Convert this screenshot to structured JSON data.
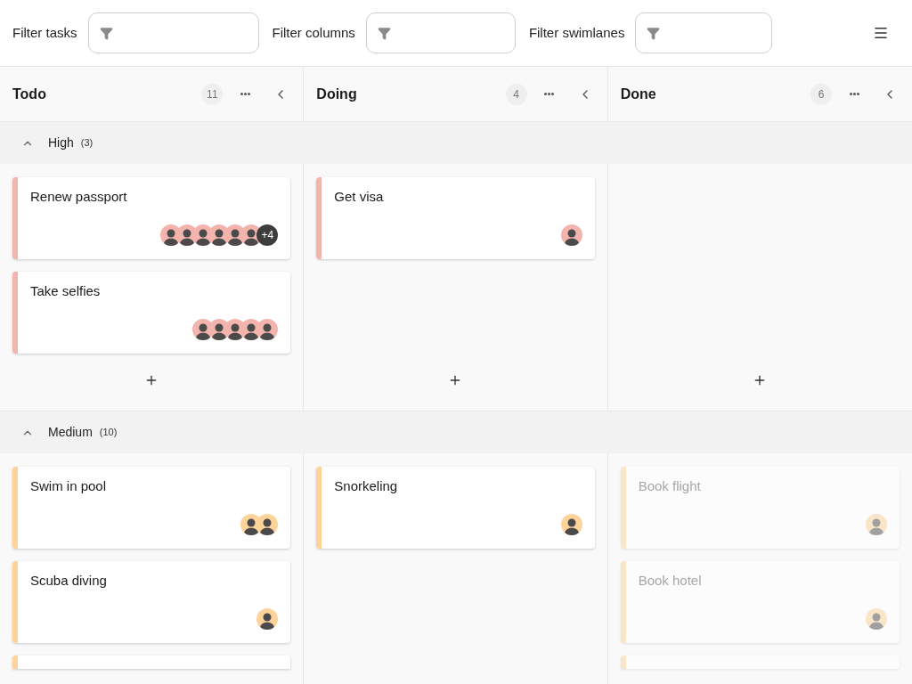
{
  "toolbar": {
    "filters": [
      {
        "label": "Filter tasks"
      },
      {
        "label": "Filter columns"
      },
      {
        "label": "Filter swimlanes"
      }
    ]
  },
  "columns": [
    {
      "title": "Todo",
      "count": "11"
    },
    {
      "title": "Doing",
      "count": "4"
    },
    {
      "title": "Done",
      "count": "6"
    }
  ],
  "swimlanes": [
    {
      "title": "High",
      "count": "(3)",
      "expanded": true,
      "color": "#f4b4ae",
      "add_button": true,
      "cells": [
        {
          "cards": [
            {
              "kind": "task",
              "title": "Renew passport",
              "completed": false,
              "avatars": [
                {
                  "kind": "photo"
                },
                {
                  "kind": "photo"
                },
                {
                  "kind": "photo"
                },
                {
                  "kind": "photo"
                },
                {
                  "kind": "photo"
                },
                {
                  "kind": "photo"
                },
                {
                  "kind": "more",
                  "label": "+4"
                }
              ]
            },
            {
              "kind": "task",
              "title": "Take selfies",
              "completed": false,
              "avatars": [
                {
                  "kind": "photo"
                },
                {
                  "kind": "photo"
                },
                {
                  "kind": "photo"
                },
                {
                  "kind": "photo"
                },
                {
                  "kind": "photo"
                }
              ]
            }
          ]
        },
        {
          "cards": [
            {
              "kind": "task",
              "title": "Get visa",
              "completed": false,
              "avatars": [
                {
                  "kind": "photo"
                }
              ]
            }
          ]
        },
        {}
      ]
    },
    {
      "title": "Medium",
      "count": "(10)",
      "expanded": true,
      "color": "#fdd39a",
      "cells": [
        {
          "cards": [
            {
              "kind": "task",
              "title": "Swim in pool",
              "completed": false,
              "avatars": [
                {
                  "kind": "photo"
                },
                {
                  "kind": "photo"
                }
              ]
            },
            {
              "kind": "task",
              "title": "Scuba diving",
              "completed": false,
              "avatars": [
                {
                  "kind": "photo"
                }
              ]
            },
            {
              "kind": "partial",
              "completed": false
            }
          ]
        },
        {
          "cards": [
            {
              "kind": "task",
              "title": "Snorkeling",
              "completed": false,
              "avatars": [
                {
                  "kind": "photo"
                }
              ]
            }
          ]
        },
        {
          "cards": [
            {
              "kind": "task",
              "title": "Book flight",
              "completed": true,
              "avatars": [
                {
                  "kind": "photo"
                }
              ]
            },
            {
              "kind": "task",
              "title": "Book hotel",
              "completed": true,
              "avatars": [
                {
                  "kind": "photo"
                }
              ]
            },
            {
              "kind": "partial",
              "completed": true
            }
          ]
        }
      ]
    }
  ]
}
